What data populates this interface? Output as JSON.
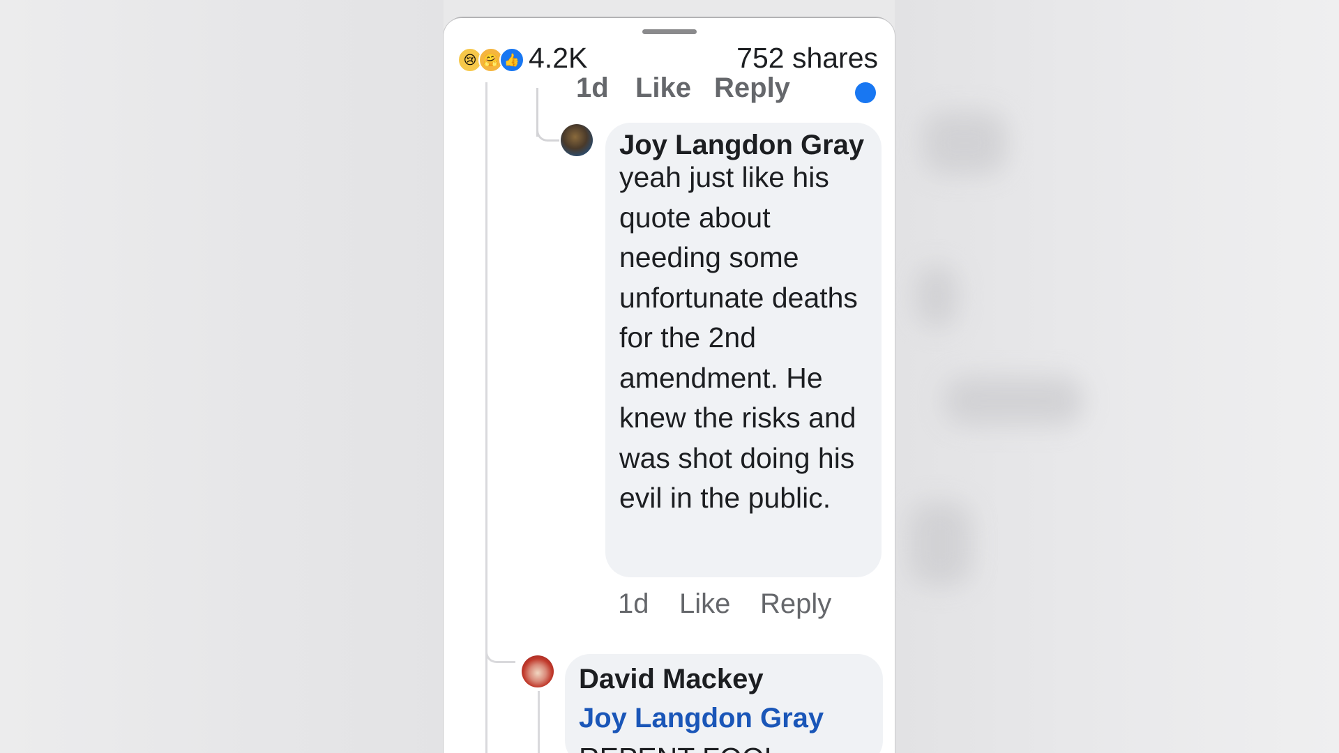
{
  "post_stats": {
    "reaction_icons": [
      "sad-reaction-icon",
      "care-reaction-icon",
      "like-reaction-icon"
    ],
    "reaction_count": "4.2K",
    "shares": "752 shares"
  },
  "cut_off_actions": {
    "time": "1d",
    "like": "Like",
    "reply": "Reply"
  },
  "comments": [
    {
      "author": "Joy Langdon Gray",
      "text": "yeah just like his quote about needing some unfortunate deaths for the 2nd amendment. He knew the risks and was shot doing his evil in the public.",
      "time": "1d",
      "like": "Like",
      "reply": "Reply"
    },
    {
      "author": "David Mackey",
      "mention": "Joy Langdon Gray",
      "text": "REPENT FOOL"
    }
  ],
  "colors": {
    "mention": "#1a56b8",
    "bubble": "#f0f2f5",
    "secondary_text": "#65676b",
    "like_blue": "#1877f2"
  }
}
